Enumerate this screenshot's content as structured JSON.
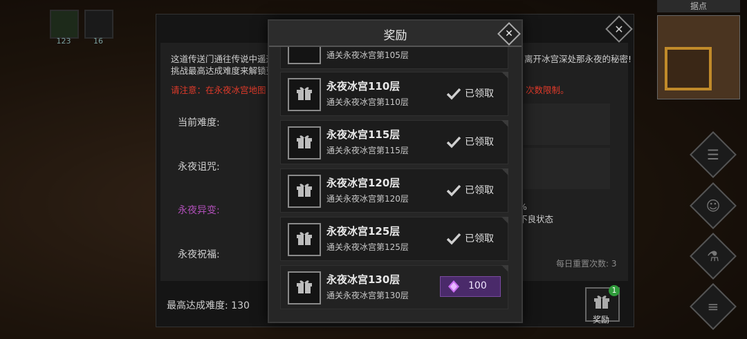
{
  "inventory": [
    {
      "count": "123"
    },
    {
      "count": "16"
    }
  ],
  "minimap": {
    "title": "据点"
  },
  "info_panel": {
    "description_line1": "这道传送门通往传说中遥远",
    "description_line2": "挑战最高达成难度来解锁更",
    "description_right": "离开冰宫深处那永夜的秘密!",
    "warning_left": "请注意：在永夜冰宫地图",
    "warning_right": "次数限制。",
    "labels": {
      "difficulty": "当前难度:",
      "curse": "永夜诅咒:",
      "mutation": "永夜异变:",
      "blessing": "永夜祝福:"
    },
    "mutation_note_1": "%",
    "mutation_note_2": "不良状态",
    "reset_count": "每日重置次数: 3",
    "highest_difficulty": "最高达成难度: 130"
  },
  "reward_button": {
    "label": "奖励",
    "badge": "1"
  },
  "modal": {
    "title": "奖励",
    "partial_item_sub": "通关永夜冰宫第105层",
    "items": [
      {
        "title": "永夜冰宫110层",
        "subtitle": "通关永夜冰宫第110层",
        "status": "已领取"
      },
      {
        "title": "永夜冰宫115层",
        "subtitle": "通关永夜冰宫第115层",
        "status": "已领取"
      },
      {
        "title": "永夜冰宫120层",
        "subtitle": "通关永夜冰宫第120层",
        "status": "已领取"
      },
      {
        "title": "永夜冰宫125层",
        "subtitle": "通关永夜冰宫第125层",
        "status": "已领取"
      },
      {
        "title": "永夜冰宫130层",
        "subtitle": "通关永夜冰宫第130层",
        "reward_amount": "100"
      }
    ]
  },
  "colors": {
    "warning": "#e03a2a",
    "mutation": "#b04fb8",
    "gem_button": "#4a2a6a",
    "badge": "#2f9a3a"
  }
}
